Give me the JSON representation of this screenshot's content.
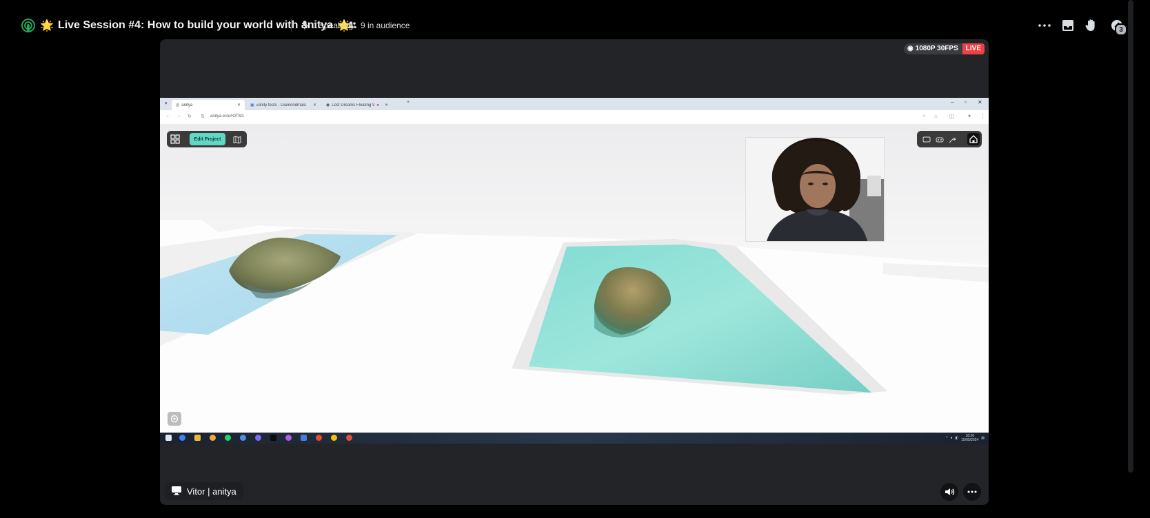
{
  "header": {
    "title": "Live Session #4: How to build your world with anitya",
    "title_decoration": "🌟",
    "speaking": "1 speaking",
    "audience": "9 in audience",
    "notification_badge": "3",
    "icons": [
      "stage-icon",
      "microphone-icon",
      "audience-icon",
      "more-icon",
      "inbox-icon",
      "raise-hand-icon",
      "notification-icon"
    ]
  },
  "stream": {
    "quality": "1080P 30FPS",
    "live_label": "LIVE",
    "streamer": "Vitor | anitya",
    "accent": "#ed4245"
  },
  "shared_screen": {
    "browser": {
      "tabs": [
        {
          "label": "anitya"
        },
        {
          "label": "vanity tests - Diamondmass Gilt..."
        },
        {
          "label": "Lost Dreams Floating Worl..."
        }
      ],
      "new_tab_icon": "+",
      "url": "anitya.eco/#OTM1"
    },
    "app": {
      "edit_project_label": "Edit Project",
      "accent": "#63d7c6",
      "water_color": "#79dbd0"
    },
    "taskbar": {
      "time": "18:26",
      "date": "15/05/2024"
    }
  }
}
